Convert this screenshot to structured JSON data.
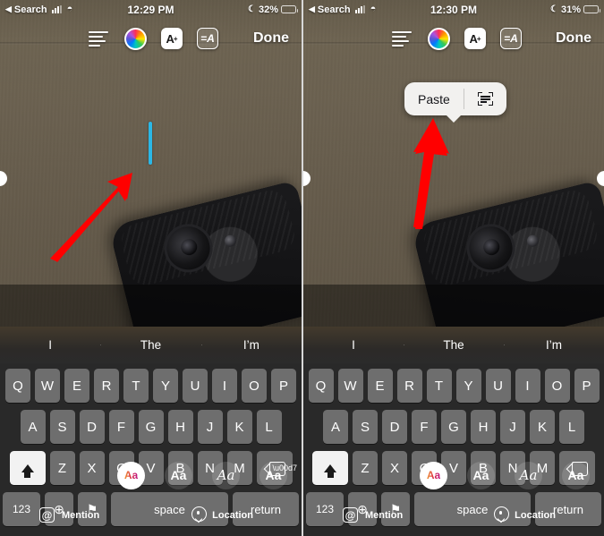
{
  "app": {
    "name": "instagram-story-text-editor",
    "accent_blue": "#2bb7e6",
    "arrow_color": "#ff0000"
  },
  "panels": [
    {
      "id": "left",
      "status_bar": {
        "back_label": "Search",
        "back_chevron": "◀",
        "signal_icon": "cellular-bars-icon",
        "wifi_icon": "wifi-icon",
        "wifi_glyph": "◓",
        "time": "12:29 PM",
        "moon_icon": "crescent-moon-icon",
        "moon_glyph": "☾",
        "battery_percent": "32%",
        "battery_level": 32
      },
      "toolbar": {
        "align_icon": "text-align-icon",
        "color_icon": "color-wheel-icon",
        "text_size_label": "A",
        "text_size_sup": "+",
        "text_effect_label": "=A",
        "done_label": "Done"
      },
      "caret": {
        "visible": true
      },
      "paste_popup": {
        "visible": false
      },
      "font_pills": [
        {
          "label": "Aa",
          "style": "classic",
          "active": true
        },
        {
          "label": "Aa",
          "style": "modern",
          "active": false
        },
        {
          "label": "Aa",
          "style": "neon-script",
          "active": false
        },
        {
          "label": "Aa",
          "style": "typewriter",
          "active": false
        }
      ],
      "actions": [
        {
          "icon": "at-sign-icon",
          "glyph": "@",
          "label": "Mention"
        },
        {
          "icon": "location-pin-icon",
          "label": "Location"
        }
      ],
      "keyboard": {
        "suggestions": [
          "I",
          "The",
          "I’m"
        ],
        "row1": [
          "Q",
          "W",
          "E",
          "R",
          "T",
          "Y",
          "U",
          "I",
          "O",
          "P"
        ],
        "row2": [
          "A",
          "S",
          "D",
          "F",
          "G",
          "H",
          "J",
          "K",
          "L"
        ],
        "row3": [
          "Z",
          "X",
          "C",
          "V",
          "B",
          "N",
          "M"
        ],
        "shift_icon": "shift-up-arrow-icon",
        "delete_icon": "backspace-delete-icon",
        "numbers_label": "123",
        "globe_icon": "globe-language-icon",
        "globe_glyph": "⊕",
        "mic_icon": "microphone-icon",
        "mic_glyph": "⚑",
        "space_label": "space",
        "return_label": "return"
      }
    },
    {
      "id": "right",
      "status_bar": {
        "back_label": "Search",
        "back_chevron": "◀",
        "signal_icon": "cellular-bars-icon",
        "wifi_icon": "wifi-icon",
        "wifi_glyph": "◓",
        "time": "12:30 PM",
        "moon_icon": "crescent-moon-icon",
        "moon_glyph": "☾",
        "battery_percent": "31%",
        "battery_level": 31
      },
      "toolbar": {
        "align_icon": "text-align-icon",
        "color_icon": "color-wheel-icon",
        "text_size_label": "A",
        "text_size_sup": "+",
        "text_effect_label": "=A",
        "done_label": "Done"
      },
      "caret": {
        "visible": false
      },
      "paste_popup": {
        "visible": true,
        "paste_label": "Paste",
        "scan_icon": "scan-text-icon"
      },
      "font_pills": [
        {
          "label": "Aa",
          "style": "classic",
          "active": true
        },
        {
          "label": "Aa",
          "style": "modern",
          "active": false
        },
        {
          "label": "Aa",
          "style": "neon-script",
          "active": false
        },
        {
          "label": "Aa",
          "style": "typewriter",
          "active": false
        }
      ],
      "actions": [
        {
          "icon": "at-sign-icon",
          "glyph": "@",
          "label": "Mention"
        },
        {
          "icon": "location-pin-icon",
          "label": "Location"
        }
      ],
      "keyboard": {
        "suggestions": [
          "I",
          "The",
          "I’m"
        ],
        "row1": [
          "Q",
          "W",
          "E",
          "R",
          "T",
          "Y",
          "U",
          "I",
          "O",
          "P"
        ],
        "row2": [
          "A",
          "S",
          "D",
          "F",
          "G",
          "H",
          "J",
          "K",
          "L"
        ],
        "row3": [
          "Z",
          "X",
          "C",
          "V",
          "B",
          "N",
          "M"
        ],
        "shift_icon": "shift-up-arrow-icon",
        "delete_icon": "backspace-delete-icon",
        "numbers_label": "123",
        "globe_icon": "globe-language-icon",
        "globe_glyph": "⊕",
        "mic_icon": "microphone-icon",
        "mic_glyph": "⚑",
        "space_label": "space",
        "return_label": "return"
      }
    }
  ]
}
